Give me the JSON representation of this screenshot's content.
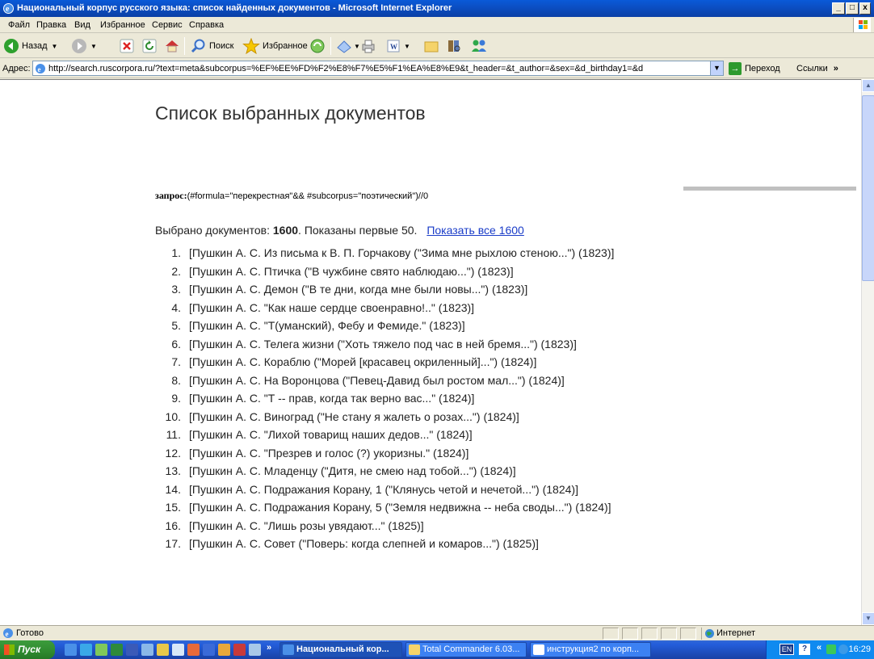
{
  "window": {
    "title": "Национальный корпус русского языка: список найденных документов - Microsoft Internet Explorer",
    "minimize": "_",
    "maximize": "□",
    "close": "x"
  },
  "menu": [
    "Файл",
    "Правка",
    "Вид",
    "Избранное",
    "Сервис",
    "Справка"
  ],
  "toolbar": {
    "back_label": "Назад",
    "search_label": "Поиск",
    "favorites_label": "Избранное"
  },
  "address": {
    "label": "Адрес:",
    "url": "http://search.ruscorpora.ru/?text=meta&subcorpus=%EF%EE%FD%F2%E8%F7%E5%F1%EA%E8%E9&t_header=&t_author=&sex=&d_birthday1=&d",
    "go_label": "Переход",
    "links_label": "Ссылки"
  },
  "page": {
    "title": "Список выбранных документов",
    "query_label": "запрос:",
    "query_value": "(#formula=\"перекрестная\"&& #subcorpus=\"поэтический\")//0",
    "summary_prefix": "Выбрано документов:",
    "summary_count": "1600",
    "summary_suffix": ". Показаны первые 50.",
    "show_all_link": "Показать все 1600",
    "documents": [
      "[Пушкин А. С. Из письма к В. П. Горчакову (\"Зима мне рыхлою стеною...\") (1823)]",
      "[Пушкин А. С. Птичка (\"В чужбине свято наблюдаю...\") (1823)]",
      "[Пушкин А. С. Демон (\"В те дни, когда мне были новы...\") (1823)]",
      "[Пушкин А. С. \"Как наше сердце своенравно!..\" (1823)]",
      "[Пушкин А. С. \"Т(уманский), Фебу и Фемиде.\" (1823)]",
      "[Пушкин А. С. Телега жизни (\"Хоть тяжело под час в ней бремя...\") (1823)]",
      "[Пушкин А. С. Кораблю (\"Морей [красавец окриленный]...\") (1824)]",
      "[Пушкин А. С. На Воронцова (\"Певец-Давид был ростом мал...\") (1824)]",
      "[Пушкин А. С. \"Т -- прав, когда так верно вас...\" (1824)]",
      "[Пушкин А. С. Виноград (\"Не стану я жалеть о розах...\") (1824)]",
      "[Пушкин А. С. \"Лихой товарищ наших дедов...\" (1824)]",
      "[Пушкин А. С. \"Презрев и голос (?) укоризны.\" (1824)]",
      "[Пушкин А. С. Младенцу (\"Дитя, не смею над тобой...\") (1824)]",
      "[Пушкин А. С. Подражания Корану, 1 (\"Клянусь четой и нечетой...\") (1824)]",
      "[Пушкин А. С. Подражания Корану, 5 (\"Земля недвижна -- неба своды...\") (1824)]",
      "[Пушкин А. С. \"Лишь розы увядают...\" (1825)]",
      "[Пушкин А. С. Совет (\"Поверь: когда слепней и комаров...\") (1825)]"
    ]
  },
  "status": {
    "ready": "Готово",
    "zone": "Интернет"
  },
  "taskbar": {
    "start": "Пуск",
    "chevron": "»",
    "tasks": [
      "Национальный кор...",
      "Total Commander 6.03...",
      "инструкция2 по корп..."
    ],
    "lang": "EN",
    "clock": "16:29"
  },
  "colors": {
    "titlebar": "#0a4fc4",
    "link": "#1a3cc8",
    "taskbar": "#245edb",
    "start": "#2f8a2f"
  }
}
